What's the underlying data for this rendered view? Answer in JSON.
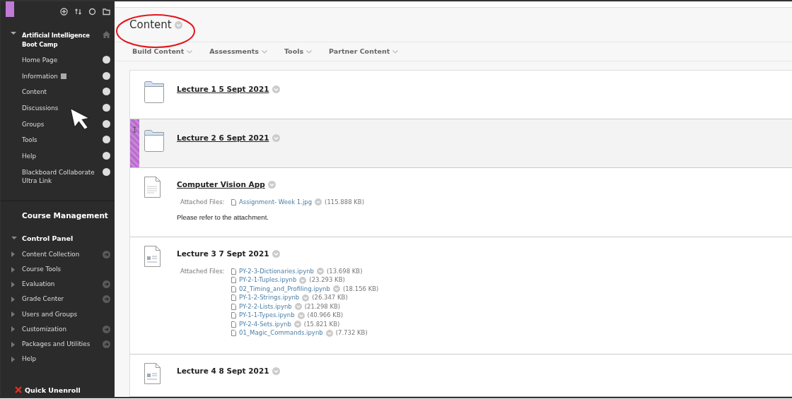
{
  "sidebar": {
    "course_title": "Artificial Intelligence Boot Camp",
    "menu_items": [
      {
        "label": "Home Page",
        "badge": false
      },
      {
        "label": "Information",
        "badge": true
      },
      {
        "label": "Content",
        "badge": false
      },
      {
        "label": "Discussions",
        "badge": false
      },
      {
        "label": "Groups",
        "badge": false
      },
      {
        "label": "Tools",
        "badge": false
      },
      {
        "label": "Help",
        "badge": false
      },
      {
        "label": "Blackboard Collaborate Ultra Link",
        "badge": false
      }
    ],
    "management_title": "Course Management",
    "control_panel": {
      "label": "Control Panel",
      "expanded": true,
      "items": [
        {
          "label": "Content Collection",
          "has_arrow": true
        },
        {
          "label": "Course Tools",
          "has_arrow": false
        },
        {
          "label": "Evaluation",
          "has_arrow": true
        },
        {
          "label": "Grade Center",
          "has_arrow": true
        },
        {
          "label": "Users and Groups",
          "has_arrow": false
        },
        {
          "label": "Customization",
          "has_arrow": true
        },
        {
          "label": "Packages and Utilities",
          "has_arrow": true
        },
        {
          "label": "Help",
          "has_arrow": false
        }
      ]
    },
    "quick_unenroll": "Quick Unenroll"
  },
  "page_title": "Content",
  "toolbar": [
    "Build Content",
    "Assessments",
    "Tools",
    "Partner Content"
  ],
  "content_items": [
    {
      "kind": "folder",
      "title": "Lecture 1 5 Sept 2021",
      "linked": true,
      "selected": false
    },
    {
      "kind": "folder",
      "title": "Lecture 2 6 Sept 2021",
      "linked": true,
      "selected": true
    },
    {
      "kind": "document",
      "title": "Computer Vision App",
      "linked": true,
      "selected": false,
      "attached_label": "Attached Files:",
      "files": [
        {
          "name": "Assignment- Week 1.jpg",
          "size": "(115.888 KB)"
        }
      ],
      "description": "Please refer to the attachment."
    },
    {
      "kind": "item",
      "title": "Lecture 3 7 Sept 2021",
      "linked": false,
      "selected": false,
      "attached_label": "Attached Files:",
      "files": [
        {
          "name": "PY-2-3-Dictionaries.ipynb",
          "size": "(13.698 KB)"
        },
        {
          "name": "PY-2-1-Tuples.ipynb",
          "size": "(23.293 KB)"
        },
        {
          "name": "02_Timing_and_Profiling.ipynb",
          "size": "(18.156 KB)"
        },
        {
          "name": "PY-1-2-Strings.ipynb",
          "size": "(26.347 KB)"
        },
        {
          "name": "PY-2-2-Lists.ipynb",
          "size": "(21.298 KB)"
        },
        {
          "name": "PY-1-1-Types.ipynb",
          "size": "(40.966 KB)"
        },
        {
          "name": "PY-2-4-Sets.ipynb",
          "size": "(15.821 KB)"
        },
        {
          "name": "01_Magic_Commands.ipynb",
          "size": "(7.732 KB)"
        }
      ]
    },
    {
      "kind": "item",
      "title": "Lecture 4 8 Sept 2021",
      "linked": false,
      "selected": false
    }
  ]
}
